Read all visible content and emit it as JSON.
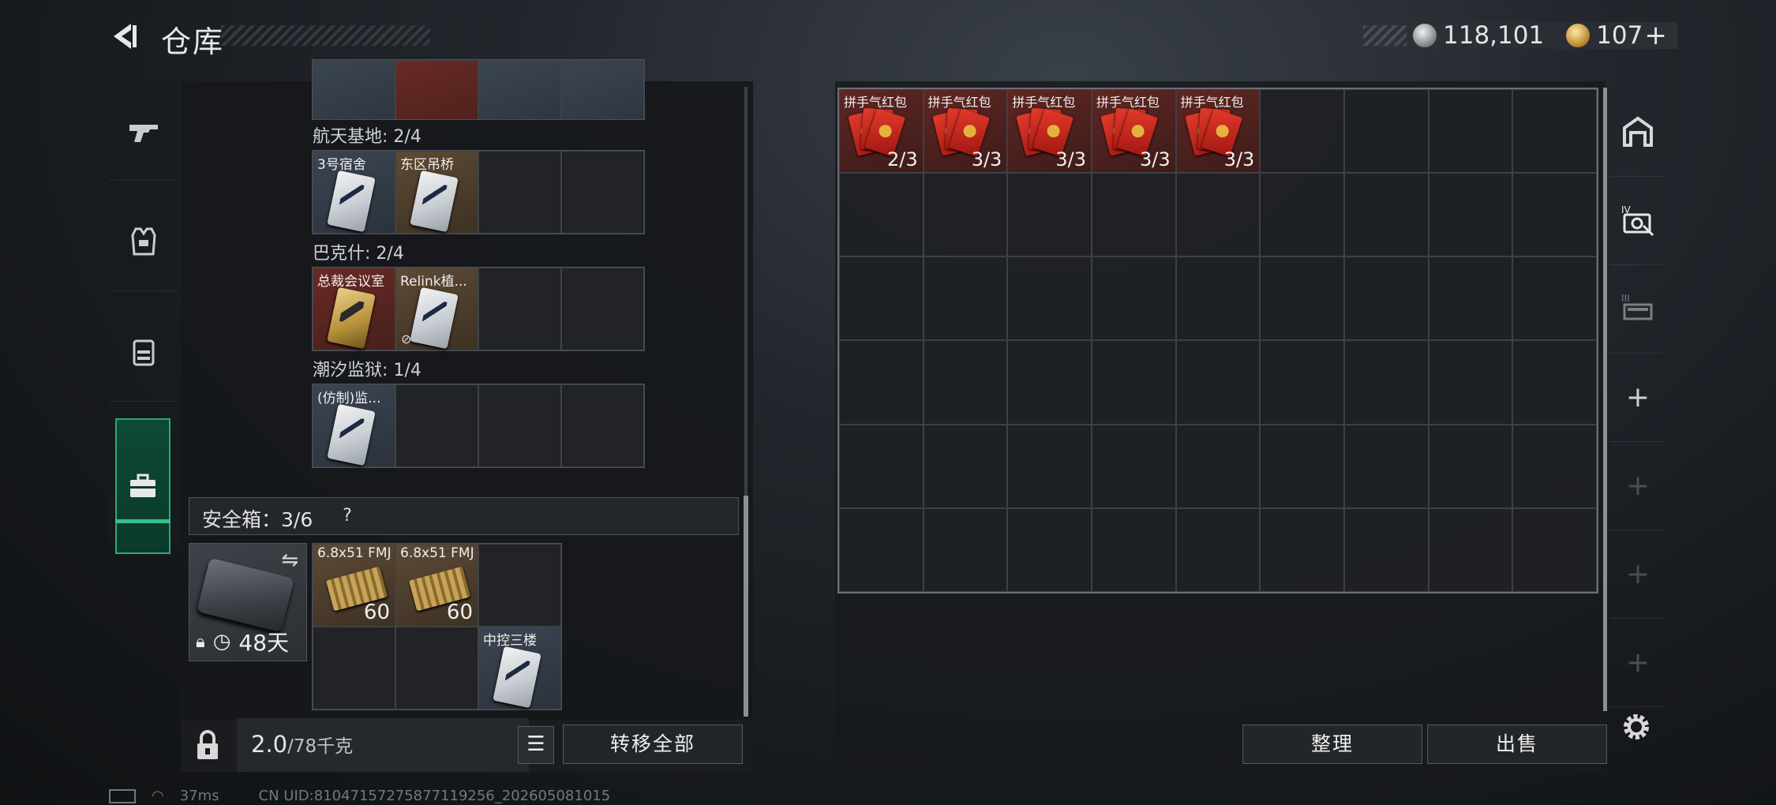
{
  "header": {
    "title": "仓库",
    "currency_silver": "118,101",
    "currency_gold": "107",
    "gold_plus": "+"
  },
  "left_rail": {
    "tabs": [
      "weapon",
      "armor",
      "backpack",
      "toolbox"
    ],
    "active": "toolbox"
  },
  "key_groups": [
    {
      "label": "航天基地: 2/4",
      "items": [
        {
          "name": "3号宿舍",
          "rarity": "blue"
        },
        {
          "name": "东区吊桥",
          "rarity": "orange"
        }
      ]
    },
    {
      "label": "巴克什: 2/4",
      "items": [
        {
          "name": "总裁会议室",
          "rarity": "red"
        },
        {
          "name": "Relink植...",
          "rarity": "orange",
          "no_link": true
        }
      ]
    },
    {
      "label": "潮汐监狱: 1/4",
      "items": [
        {
          "name": "(仿制)监...",
          "rarity": "blue"
        }
      ]
    }
  ],
  "safe_box": {
    "label": "安全箱：3/6",
    "help": "?",
    "days": "48天",
    "items": [
      {
        "name": "6.8x51 FMJ",
        "qty": "60"
      },
      {
        "name": "6.8x51 FMJ",
        "qty": "60"
      },
      {
        "name": "中控三楼",
        "qty": ""
      }
    ]
  },
  "weight": {
    "current": "2.0",
    "max": "/78千克"
  },
  "buttons": {
    "transfer_all": "转移全部",
    "organize": "整理",
    "sell": "出售"
  },
  "stash_items": [
    {
      "name": "拼手气红包",
      "qty": "2/3"
    },
    {
      "name": "拼手气红包",
      "qty": "3/3"
    },
    {
      "name": "拼手气红包",
      "qty": "3/3"
    },
    {
      "name": "拼手气红包",
      "qty": "3/3"
    },
    {
      "name": "拼手气红包",
      "qty": "3/3"
    }
  ],
  "status_bar": {
    "ping": "37ms",
    "uid": "CN UID:810471572758771192​56_202605081015"
  },
  "colors": {
    "accent_green": "#39c08a",
    "rarity_red": "#6a2a24",
    "rarity_orange": "#5d4a34",
    "rarity_blue": "#3b4552"
  }
}
